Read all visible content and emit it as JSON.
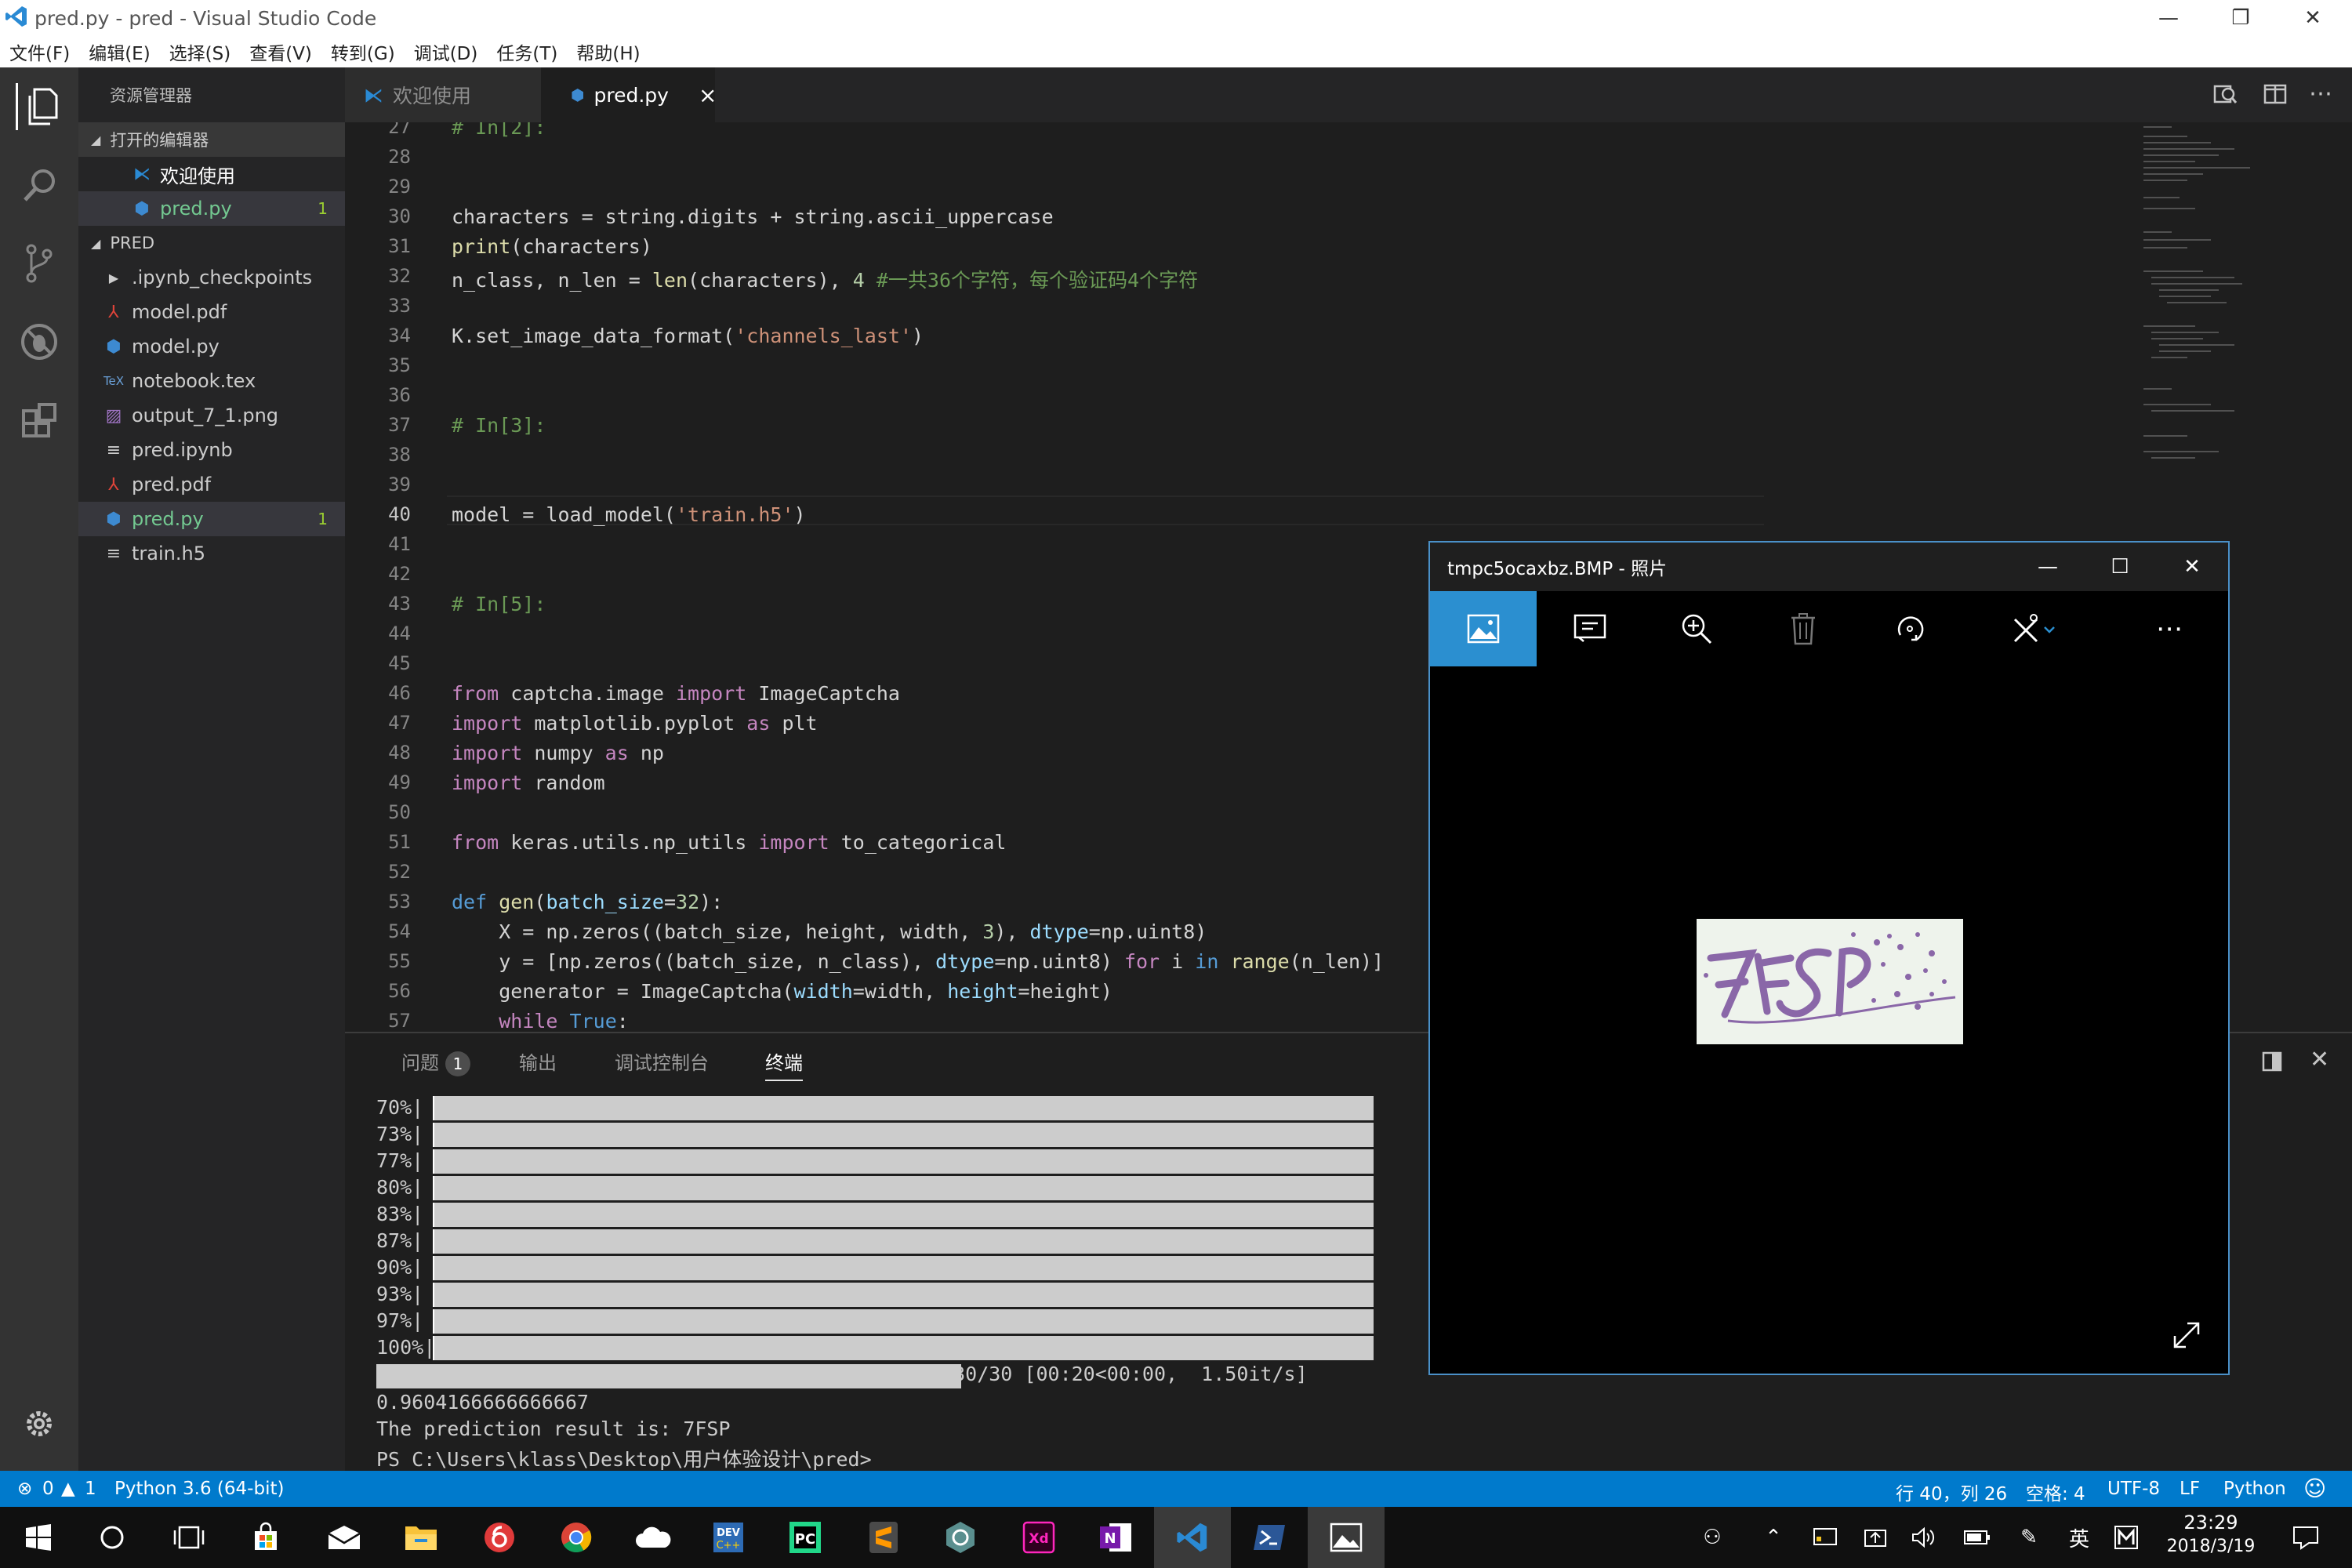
{
  "window": {
    "title": "pred.py - pred - Visual Studio Code"
  },
  "menu": [
    "文件(F)",
    "编辑(E)",
    "选择(S)",
    "查看(V)",
    "转到(G)",
    "调试(D)",
    "任务(T)",
    "帮助(H)"
  ],
  "sidebar": {
    "header": "资源管理器",
    "open_editors_label": "打开的编辑器",
    "open_editors": [
      {
        "name": "欢迎使用",
        "icon": "vscode-icon"
      },
      {
        "name": "pred.py",
        "icon": "python-icon",
        "badge": "1"
      }
    ],
    "folder_label": "PRED",
    "files": [
      {
        "name": ".ipynb_checkpoints",
        "icon": "chevron-right-icon"
      },
      {
        "name": "model.pdf",
        "icon": "pdf-icon"
      },
      {
        "name": "model.py",
        "icon": "python-icon"
      },
      {
        "name": "notebook.tex",
        "icon": "tex-icon"
      },
      {
        "name": "output_7_1.png",
        "icon": "image-icon"
      },
      {
        "name": "pred.ipynb",
        "icon": "lines-icon"
      },
      {
        "name": "pred.pdf",
        "icon": "pdf-icon"
      },
      {
        "name": "pred.py",
        "icon": "python-icon",
        "badge": "1"
      },
      {
        "name": "train.h5",
        "icon": "lines-icon"
      }
    ]
  },
  "tabs": [
    {
      "label": "欢迎使用",
      "icon": "vscode-icon"
    },
    {
      "label": "pred.py",
      "icon": "python-icon",
      "close": "×"
    }
  ],
  "editor": {
    "line_numbers": [
      "27",
      "28",
      "29",
      "30",
      "31",
      "32",
      "33",
      "34",
      "35",
      "36",
      "37",
      "38",
      "39",
      "40",
      "41",
      "42",
      "43",
      "44",
      "45",
      "46",
      "47",
      "48",
      "49",
      "50",
      "51",
      "52",
      "53",
      "54",
      "55",
      "56",
      "57"
    ],
    "code": {
      "l27": "# In[2]:",
      "l30": "characters = string.digits + string.ascii_uppercase",
      "l31a": "print",
      "l31b": "(characters)",
      "l32a": "n_class, n_len = ",
      "l32b": "len",
      "l32c": "(characters), ",
      "l32d": "4",
      "l32e": " #一共36个字符，每个验证码4个字符",
      "l34a": "K.set_image_data_format(",
      "l34b": "'channels_last'",
      "l34c": ")",
      "l37": "# In[3]:",
      "l40a": "model = load_model(",
      "l40b": "'train.h5'",
      "l40c": ")",
      "l43": "# In[5]:",
      "l46a": "from",
      "l46b": " captcha.image ",
      "l46c": "import",
      "l46d": " ImageCaptcha",
      "l47a": "import",
      "l47b": " matplotlib.pyplot ",
      "l47c": "as",
      "l47d": " plt",
      "l48a": "import",
      "l48b": " numpy ",
      "l48c": "as",
      "l48d": " np",
      "l49a": "import",
      "l49b": " random",
      "l51a": "from",
      "l51b": " keras.utils.np_utils ",
      "l51c": "import",
      "l51d": " to_categorical",
      "l53a": "def",
      "l53b": " gen",
      "l53c": "(",
      "l53d": "batch_size",
      "l53e": "=",
      "l53f": "32",
      "l53g": "):",
      "l54a": "    X = np.zeros((batch_size, height, width, ",
      "l54b": "3",
      "l54c": "), ",
      "l54d": "dtype",
      "l54e": "=np.uint8)",
      "l55a": "    y = [np.zeros((batch_size, n_class), ",
      "l55b": "dtype",
      "l55c": "=np.uint8) ",
      "l55d": "for",
      "l55e": " i ",
      "l55f": "in",
      "l55g": " ",
      "l55h": "range",
      "l55i": "(n_len)]",
      "l56a": "    generator = ImageCaptcha(",
      "l56b": "width",
      "l56c": "=width, ",
      "l56d": "height",
      "l56e": "=height)",
      "l57a": "    ",
      "l57b": "while",
      "l57c": " True",
      "l57d": ":"
    }
  },
  "panel": {
    "tabs": [
      {
        "label": "问题",
        "badge": "1"
      },
      {
        "label": "输出"
      },
      {
        "label": "调试控制台"
      },
      {
        "label": "终端"
      }
    ],
    "progress_labels": [
      "70%|",
      "73%|",
      "77%|",
      "80%|",
      "83%|",
      "87%|",
      "90%|",
      "93%|",
      "97%|",
      "100%|"
    ],
    "final_bar_text": "| 30/30 [00:20<00:00,  1.50it/s]",
    "accuracy": "0.9604166666666667",
    "result": "The prediction result is: 7FSP",
    "prompt": "PS C:\\Users\\klass\\Desktop\\用户体验设计\\pred>"
  },
  "statusbar": {
    "errors": "0",
    "warnings": "1",
    "interpreter": "Python 3.6 (64-bit)",
    "position": "行 40，列 26",
    "spaces": "空格: 4",
    "encoding": "UTF-8",
    "eol": "LF",
    "language": "Python"
  },
  "photos": {
    "title": "tmpc5ocaxbz.BMP - 照片",
    "captcha_text": "7FSP"
  },
  "taskbar": {
    "ime": "英",
    "time": "23:29",
    "date": "2018/3/19"
  },
  "colors": {
    "accent": "#007acc",
    "photos_accent": "#2b8fd0",
    "comment": "#6a9955",
    "keyword": "#c586c0",
    "string": "#ce9178"
  }
}
